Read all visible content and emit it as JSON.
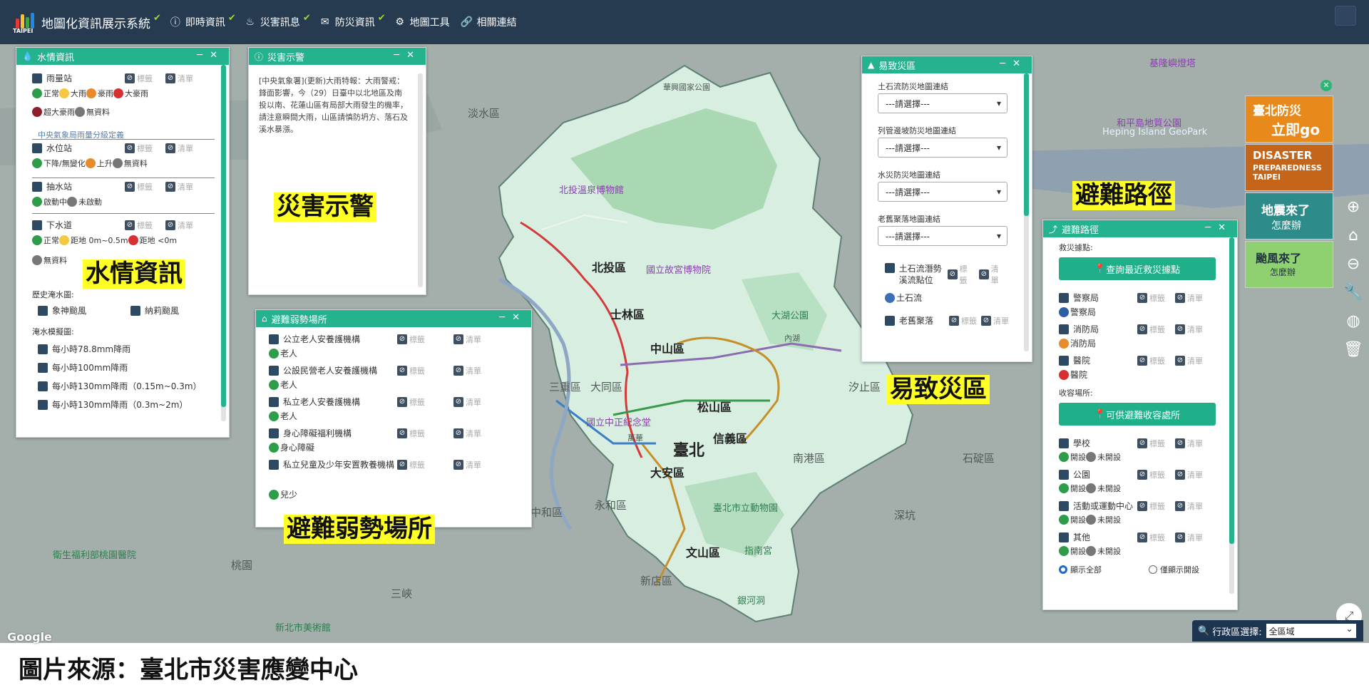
{
  "header": {
    "title": "地圖化資訊展示系統",
    "logo_text": "TAIPEI",
    "menu": [
      {
        "label": "即時資訊",
        "icon": "info-icon"
      },
      {
        "label": "災害訊息",
        "icon": "fire-icon"
      },
      {
        "label": "防災資訊",
        "icon": "mail-icon"
      },
      {
        "label": "地圖工具",
        "icon": "gear-icon"
      },
      {
        "label": "相關連結",
        "icon": "link-icon"
      }
    ]
  },
  "map": {
    "labels": {
      "huaju": "華興國家公園",
      "tamsui": "淡水區",
      "beitou": "北投區",
      "shilin": "士林區",
      "zhongshan": "中山區",
      "datong": "大同區",
      "songshan": "松山區",
      "xinyi": "信義區",
      "daan": "大安區",
      "wenshan": "文山區",
      "nangang": "南港區",
      "taipei": "臺北",
      "xindian": "新店區",
      "sanchong": "三重區",
      "zhonghe": "中和區",
      "yonghe": "永和區",
      "xizhi": "汐止區",
      "shiding": "石碇區",
      "keelung": "基隆嶼燈塔",
      "heping": "和平島地質公園",
      "heping_en": "Heping Island GeoPark",
      "bt_museum": "北投溫泉博物館",
      "npm": "國立故宮博物院",
      "cks": "國立中正紀念堂",
      "zoo": "臺北市立動物園",
      "zhinan": "指南宮",
      "dahu": "大湖公園",
      "yinhe": "銀河洞",
      "wanhua": "萬華",
      "neihu": "內湖",
      "taoyuan": "桃園",
      "mohw": "衛生福利部桃園醫院",
      "xintai": "新北市美術館",
      "shenkeng": "深坑",
      "yunlin": "三峽"
    },
    "google": "Google"
  },
  "water_panel": {
    "title": "水情資訊",
    "rain_station": "雨量站",
    "tag": "標籤",
    "list": "清單",
    "rain_legend": [
      "正常",
      "大雨",
      "豪雨",
      "大豪雨"
    ],
    "rain_legend2": [
      "超大豪雨",
      "無資料"
    ],
    "rain_sub": "中央氣象局雨量分級定義",
    "water_level": "水位站",
    "level_legend": [
      "下降/無變化",
      "上升",
      "無資料"
    ],
    "pump": "抽水站",
    "pump_legend": [
      "啟動中",
      "未啟動"
    ],
    "sewer": "下水道",
    "sewer_legend": [
      "正常",
      "距地 0m~0.5m",
      "距地 <0m"
    ],
    "sewer_nodata": "無資料",
    "hist_title": "歷史淹水圖:",
    "hist": [
      "象神颱風",
      "納莉颱風"
    ],
    "sim_title": "淹水模擬圖:",
    "sim": [
      "每小時78.8mm降雨",
      "每小時100mm降雨",
      "每小時130mm降雨（0.15m~0.3m）",
      "每小時130mm降雨（0.3m~2m）"
    ],
    "label": "水情資訊"
  },
  "warning_panel": {
    "title": "災害示警",
    "text": "[中央氣象署](更新)大雨特報：大雨警戒：鋒面影響，今（29）日臺中以北地區及南投以南、花蓮山區有局部大雨發生的機率，請注意瞬間大雨，山區請慎防坍方、落石及溪水暴漲。",
    "label": "災害示警"
  },
  "vulnerable_panel": {
    "title": "避難弱勢場所",
    "items": [
      {
        "name": "公立老人安養護機構",
        "sub": "老人"
      },
      {
        "name": "公設民營老人安養護機構",
        "sub": "老人"
      },
      {
        "name": "私立老人安養護機構",
        "sub": "老人"
      },
      {
        "name": "身心障礙福利機構",
        "sub": "身心障礙"
      },
      {
        "name": "私立兒童及少年安置教養機構",
        "sub": "兒少"
      }
    ],
    "label": "避難弱勢場所"
  },
  "hazard_panel": {
    "title": "易致災區",
    "groups": [
      {
        "label": "土石流防災地圖連結",
        "placeholder": "---請選擇---"
      },
      {
        "label": "列管邊坡防災地圖連結",
        "placeholder": "---請選擇---"
      },
      {
        "label": "水災防災地圖連結",
        "placeholder": "---請選擇---"
      },
      {
        "label": "老舊聚落地圖連結",
        "placeholder": "---請選擇---"
      }
    ],
    "debris": "土石流潛勢溪流點位",
    "debris_sub": "土石流",
    "old": "老舊聚落",
    "label": "易致災區"
  },
  "evac_panel": {
    "title": "避難路徑",
    "rescue_title": "救災據點:",
    "rescue_btn": "查詢最近救災據點",
    "rescue": [
      {
        "name": "警察局",
        "sub": "警察局"
      },
      {
        "name": "消防局",
        "sub": "消防局"
      },
      {
        "name": "醫院",
        "sub": "醫院"
      }
    ],
    "shelter_title": "收容場所:",
    "shelter_btn": "可供避難收容處所",
    "shelters": [
      "學校",
      "公園",
      "活動或運動中心",
      "其他"
    ],
    "open": "開設",
    "closed": "未開設",
    "show_all": "顯示全部",
    "show_open": "僅顯示開設",
    "label": "避難路徑"
  },
  "ads": [
    {
      "l1": "臺北防災",
      "l2": "立即go"
    },
    {
      "l1": "DISASTER",
      "l2": "PREPAREDNESS TAIPEI"
    },
    {
      "l1": "地震來了",
      "l2": "怎麼辦"
    },
    {
      "l1": "颱風來了",
      "l2": "怎麼辦"
    }
  ],
  "admin": {
    "label": "行政區選擇:",
    "value": "全區域"
  },
  "caption": "圖片來源：臺北市災害應變中心",
  "colors": {
    "header": "#263a50",
    "accent": "#25b28f",
    "label_bg": "#ffff26"
  }
}
